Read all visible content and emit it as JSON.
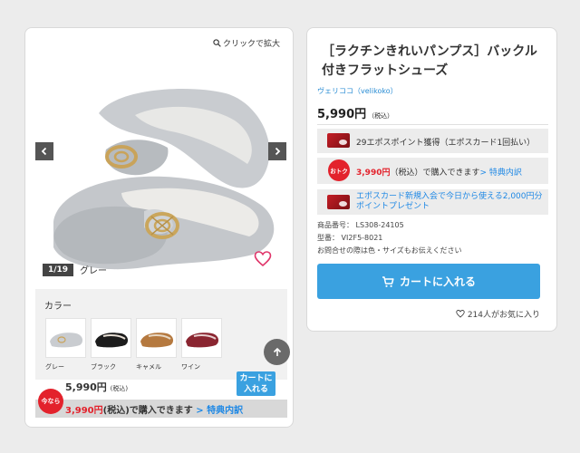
{
  "gallery": {
    "zoom_label": "クリックで拡大",
    "counter": "1/19",
    "current_color": "グレー"
  },
  "colors": {
    "title": "カラー",
    "items": [
      {
        "label": "グレー",
        "color": "#c9ccd0"
      },
      {
        "label": "ブラック",
        "color": "#1c1c1c"
      },
      {
        "label": "キャメル",
        "color": "#b5793f"
      },
      {
        "label": "ワイン",
        "color": "#8a2530"
      }
    ]
  },
  "sticky": {
    "price": "5,990円",
    "tax_note": "(税込)",
    "cart_label": "カートに入れる",
    "deal_badge": "今なら",
    "deal_price": "3,990円",
    "deal_tax": "(税込)",
    "deal_suffix": "で購入できます",
    "deal_link": "> 特典内訳"
  },
  "product": {
    "title": "［ラクチンきれいパンプス］バックル付きフラットシューズ",
    "brand": "ヴェリココ（velikoko）",
    "price": "5,990円",
    "tax_note": "（税込）",
    "points_text": "29エポスポイント獲得（エポスカード1回払い）",
    "deal_badge": "おトク",
    "deal_price": "3,990円",
    "deal_tax": "（税込）",
    "deal_suffix": "で購入できます",
    "deal_link": "> 特典内訳",
    "newcard_text": "エポスカード新規入会で今日から使える2,000円分ポイントプレゼント",
    "product_number": "商品番号： LS308-24105",
    "model_number": "型番： VI2F5-8021",
    "inquiry_note": "お問合せの際は色・サイズもお伝えください",
    "cart_button": "カートに入れる",
    "favorites": "214人がお気に入り"
  }
}
